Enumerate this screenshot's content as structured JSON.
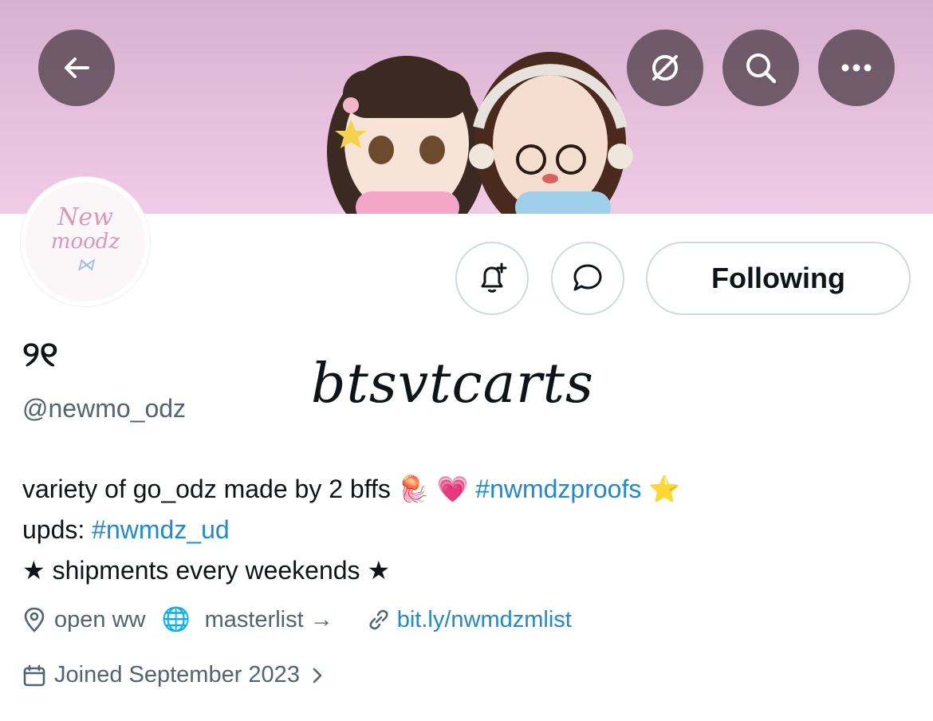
{
  "header": {
    "back_icon": "arrow-left-icon",
    "translate_icon": "slashed-circle-icon",
    "search_icon": "search-icon",
    "more_icon": "ellipsis-icon"
  },
  "avatar": {
    "logo_line1": "New",
    "logo_line2": "moodz"
  },
  "actions": {
    "notify_icon": "bell-plus-icon",
    "message_icon": "chat-bubble-icon",
    "follow_label": "Following"
  },
  "profile": {
    "display_name": "୨୧",
    "handle": "@newmo_odz",
    "overlay_text": "btsvtcarts"
  },
  "bio": {
    "line1_text": "variety of go_odz made by 2 bffs ",
    "line1_emoji1": "🪼",
    "line1_emoji2": "💗",
    "line1_hashtag": "#nwmdzproofs",
    "line1_emoji3": "⭐",
    "line2_prefix": "upds: ",
    "line2_hashtag": "#nwmdz_ud",
    "line3": "★ shipments every weekends ★"
  },
  "meta": {
    "location": "open ww",
    "globe_emoji": "🌐",
    "masterlist": "masterlist →",
    "url": "bit.ly/nwmdzmlist",
    "joined": "Joined September 2023",
    "link_color": "#1d8ad6"
  }
}
